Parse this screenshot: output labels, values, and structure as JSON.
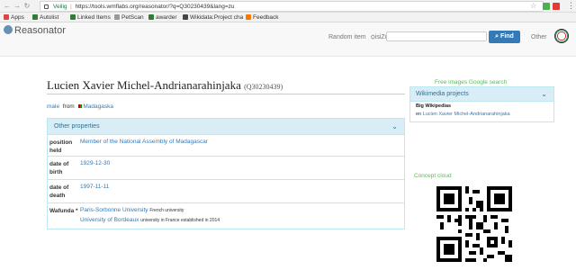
{
  "browser": {
    "secure_label": "Veilig",
    "url": "https://tools.wmflabs.org/reasonator/?q=Q30230439&lang=zu"
  },
  "bookmarks": [
    "Apps",
    "Autolist",
    "Linked Items",
    "PetScan",
    "awarder",
    "Wikidata:Project cha",
    "Feedback"
  ],
  "header": {
    "logo": "Reasonator",
    "random_item": "Random item",
    "language": "isiZulu",
    "search_value": "",
    "find_label": "Find",
    "other_label": "Other"
  },
  "entity": {
    "title": "Lucien Xavier Michel-Andrianarahinjaka",
    "qid": "(Q30230439)",
    "gender": "male",
    "from_label": "from",
    "country": "Madagaska"
  },
  "properties": {
    "header": "Other properties",
    "rows": [
      {
        "label": "position held",
        "values": [
          {
            "text": "Member of the National Assembly of Madagascar",
            "note": ""
          }
        ]
      },
      {
        "label": "date of birth",
        "values": [
          {
            "text": "1929-12-30",
            "note": ""
          }
        ]
      },
      {
        "label": "date of death",
        "values": [
          {
            "text": "1997-11-11",
            "note": ""
          }
        ]
      },
      {
        "label": "Wafunda *",
        "values": [
          {
            "text": "Paris-Sorbonne University",
            "note": "French university"
          },
          {
            "text": "University of Bordeaux",
            "note": "university in France established in 2014"
          }
        ]
      }
    ]
  },
  "sidebar": {
    "free_images": "Free images Google search",
    "wikimedia_header": "Wikimedia projects",
    "wikipedias_label": "Big Wikipedias",
    "wiki_lang": "en",
    "wiki_link": "Lucien Xavier Michel-Andrianarahinjaka",
    "concept_cloud": "Concept cloud"
  },
  "colors": {
    "accent": "#337ab7",
    "panel_head": "#d9edf7",
    "green": "#5cb85c"
  }
}
